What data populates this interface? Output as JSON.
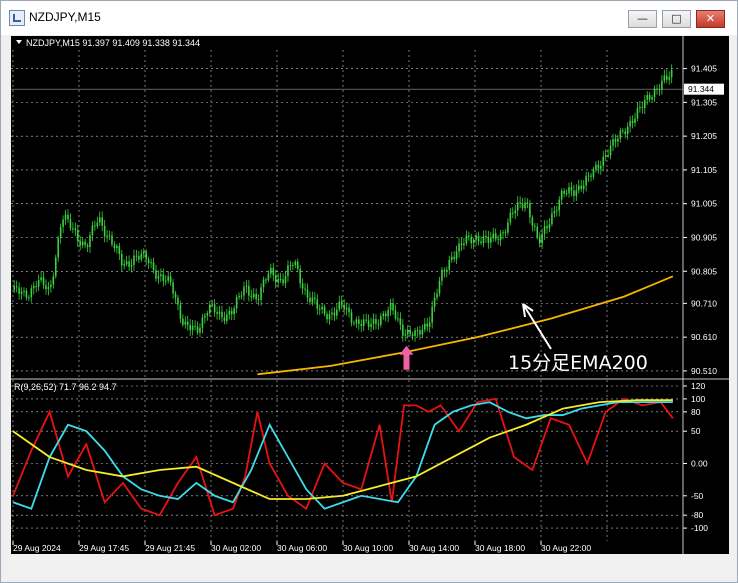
{
  "window": {
    "title": "NZDJPY,M15",
    "minimize_glyph": "—",
    "maximize_glyph": "□",
    "close_glyph": "✕"
  },
  "colors": {
    "background": "#000000",
    "grid": "#c8c8c8",
    "candle": "#39d43c",
    "ema": "#f7b500",
    "rsi_red": "#e81212",
    "rsi_cyan": "#3ddcec",
    "rsi_yellow": "#f5ec2a",
    "arrow": "#f060a0",
    "text": "#ffffff"
  },
  "chart_data": [
    {
      "type": "candlestick",
      "symbol_header": "NZDJPY,M15  91.397 91.409 91.338 91.344",
      "price_scale": [
        "91.405",
        "91.305",
        "91.205",
        "91.105",
        "91.005",
        "90.905",
        "90.805",
        "90.710",
        "90.610",
        "90.510"
      ],
      "current_price_label": "91.344",
      "current_price": 91.344,
      "ylim": [
        90.495,
        91.46
      ],
      "time_labels": [
        "29 Aug 2024",
        "29 Aug 17:45",
        "29 Aug 21:45",
        "30 Aug 02:00",
        "30 Aug 06:00",
        "30 Aug 10:00",
        "30 Aug 14:00",
        "30 Aug 18:00",
        "30 Aug 22:00"
      ],
      "series": [
        {
          "name": "close",
          "x": [
            0,
            10,
            20,
            30,
            40,
            50,
            60,
            70,
            80,
            90,
            100,
            110,
            120,
            130,
            140,
            150,
            160,
            170,
            180,
            190,
            200,
            210,
            220,
            230,
            240,
            250,
            260,
            270,
            280,
            290,
            300,
            310,
            320,
            330,
            340,
            350,
            360,
            370,
            380,
            390,
            400,
            410,
            420,
            430,
            440,
            450,
            460,
            470,
            480,
            490,
            500,
            510,
            520,
            530,
            540
          ],
          "values": [
            90.75,
            90.73,
            90.78,
            90.74,
            90.97,
            90.92,
            90.88,
            90.96,
            90.9,
            90.82,
            90.85,
            90.84,
            90.79,
            90.76,
            90.65,
            90.62,
            90.71,
            90.66,
            90.7,
            90.75,
            90.73,
            90.8,
            90.78,
            90.83,
            90.74,
            90.69,
            90.68,
            90.7,
            90.66,
            90.64,
            90.67,
            90.69,
            90.63,
            90.61,
            90.66,
            90.78,
            90.86,
            90.89,
            90.91,
            90.89,
            90.92,
            90.98,
            91.02,
            90.88,
            90.97,
            91.03,
            91.05,
            91.07,
            91.13,
            91.17,
            91.23,
            91.26,
            91.33,
            91.35,
            91.4
          ]
        },
        {
          "name": "EMA200",
          "x": [
            200,
            260,
            320,
            380,
            440,
            500,
            540
          ],
          "values": [
            90.5,
            90.525,
            90.565,
            90.61,
            90.665,
            90.73,
            90.79
          ]
        }
      ],
      "annotations": [
        {
          "text": "15分足EMA200",
          "points_to": "EMA200"
        },
        {
          "marker": "up-arrow",
          "x": 322
        }
      ]
    },
    {
      "type": "line",
      "label": "R(9,26,52) 71.7 96.2 94.7",
      "y_scale": [
        "120",
        "100",
        "80",
        "50",
        "0.00",
        "-50",
        "-80",
        "-100"
      ],
      "ylim": [
        -120,
        120
      ],
      "series": [
        {
          "name": "R9",
          "x": [
            0,
            15,
            30,
            45,
            60,
            75,
            90,
            105,
            120,
            135,
            150,
            165,
            180,
            190,
            200,
            210,
            225,
            240,
            255,
            270,
            285,
            300,
            310,
            320,
            330,
            340,
            350,
            365,
            380,
            395,
            410,
            425,
            440,
            455,
            470,
            485,
            500,
            515,
            530,
            540
          ],
          "values": [
            -50,
            20,
            80,
            -20,
            30,
            -60,
            -30,
            -70,
            -80,
            -30,
            10,
            -80,
            -70,
            -20,
            80,
            0,
            -50,
            -70,
            0,
            -30,
            -40,
            60,
            -60,
            90,
            90,
            80,
            90,
            50,
            95,
            100,
            10,
            -10,
            70,
            60,
            0,
            80,
            100,
            90,
            95,
            70
          ]
        },
        {
          "name": "R26",
          "x": [
            0,
            15,
            30,
            45,
            60,
            75,
            90,
            105,
            120,
            135,
            150,
            165,
            180,
            195,
            210,
            225,
            240,
            255,
            270,
            285,
            300,
            315,
            330,
            345,
            360,
            375,
            390,
            405,
            420,
            435,
            450,
            465,
            480,
            495,
            510,
            525,
            540
          ],
          "values": [
            -60,
            -70,
            10,
            60,
            50,
            20,
            -20,
            -40,
            -50,
            -55,
            -30,
            -50,
            -60,
            -10,
            60,
            10,
            -40,
            -70,
            -60,
            -50,
            -55,
            -60,
            -20,
            60,
            80,
            90,
            95,
            80,
            70,
            75,
            75,
            85,
            90,
            95,
            95,
            95,
            95
          ]
        },
        {
          "name": "R52",
          "x": [
            0,
            30,
            60,
            90,
            120,
            150,
            180,
            210,
            240,
            270,
            300,
            330,
            360,
            390,
            420,
            450,
            480,
            510,
            540
          ],
          "values": [
            50,
            10,
            -10,
            -20,
            -10,
            -5,
            -30,
            -55,
            -55,
            -50,
            -35,
            -20,
            10,
            40,
            60,
            85,
            95,
            98,
            98
          ]
        }
      ]
    }
  ]
}
